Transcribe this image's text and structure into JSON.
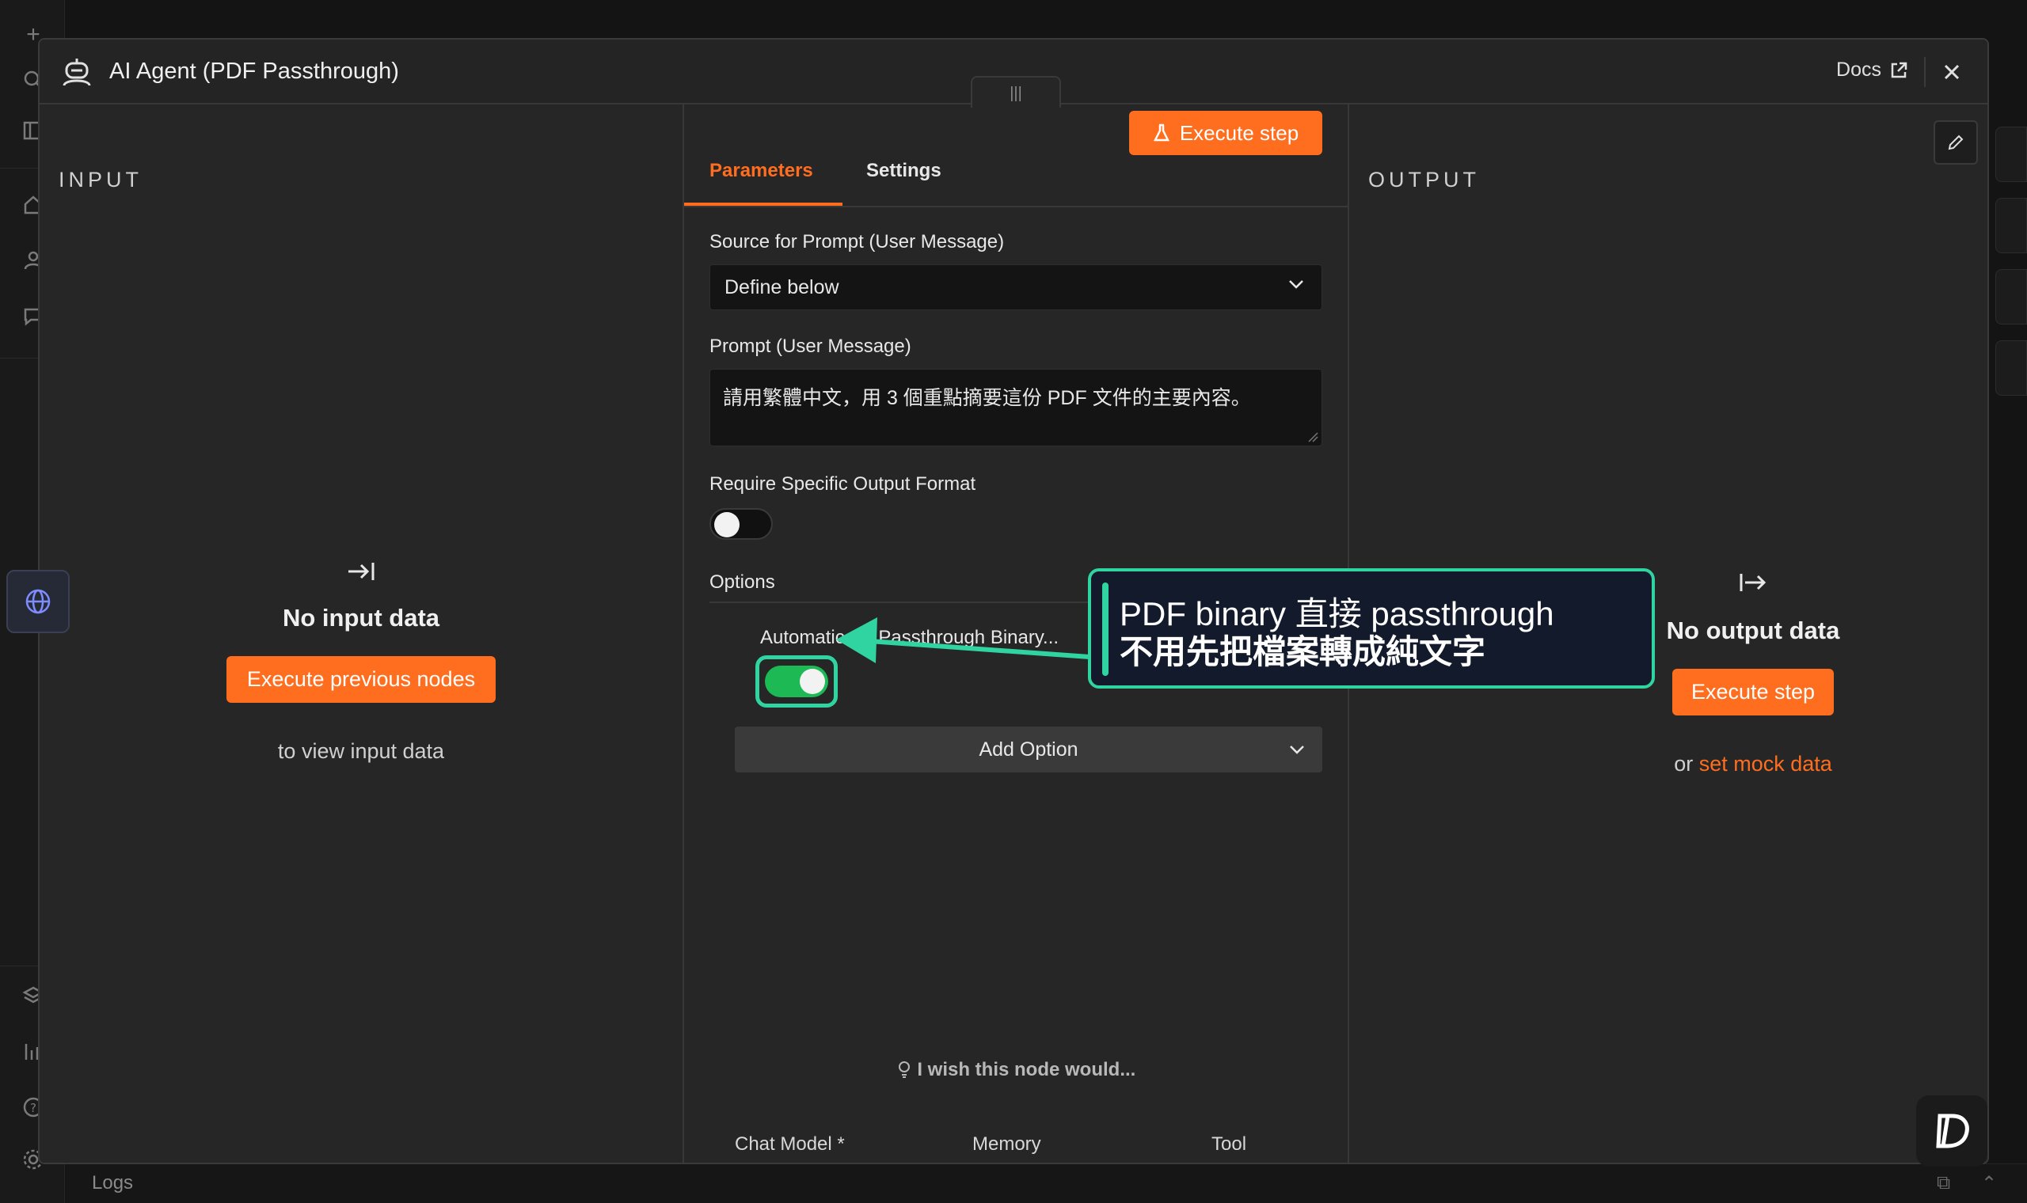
{
  "modal": {
    "title": "AI Agent (PDF Passthrough)",
    "docs_label": "Docs",
    "close_icon": "close-icon"
  },
  "input_panel": {
    "label": "INPUT",
    "empty_title": "No input data",
    "execute_button": "Execute previous nodes",
    "hint": "to view input data"
  },
  "params_panel": {
    "tabs": [
      {
        "label": "Parameters",
        "active": true
      },
      {
        "label": "Settings",
        "active": false
      }
    ],
    "execute_step_label": "Execute step",
    "source_label": "Source for Prompt (User Message)",
    "source_value": "Define below",
    "prompt_label": "Prompt (User Message)",
    "prompt_value": "請用繁體中文，用 3 個重點摘要這份 PDF 文件的主要內容。",
    "output_format_label": "Require Specific Output Format",
    "output_format_enabled": false,
    "options_label": "Options",
    "passthrough_label": "Automatically Passthrough Binary...",
    "passthrough_enabled": true,
    "add_option_label": "Add Option",
    "wish_label": "I wish this node would...",
    "sub_nodes": [
      {
        "label": "Chat Model *"
      },
      {
        "label": "Memory"
      },
      {
        "label": "Tool"
      }
    ]
  },
  "output_panel": {
    "label": "OUTPUT",
    "empty_title": "No output data",
    "execute_button": "Execute step",
    "hint_prefix": "or",
    "hint_link": "set mock data"
  },
  "annotation": {
    "line1": "PDF binary 直接 passthrough",
    "line2": "不用先把檔案轉成純文字",
    "color": "#2fd4a0"
  },
  "footer": {
    "logs_label": "Logs"
  },
  "colors": {
    "accent": "#ff6d1f",
    "toggle_on": "#1db954",
    "annotation": "#2fd4a0"
  }
}
